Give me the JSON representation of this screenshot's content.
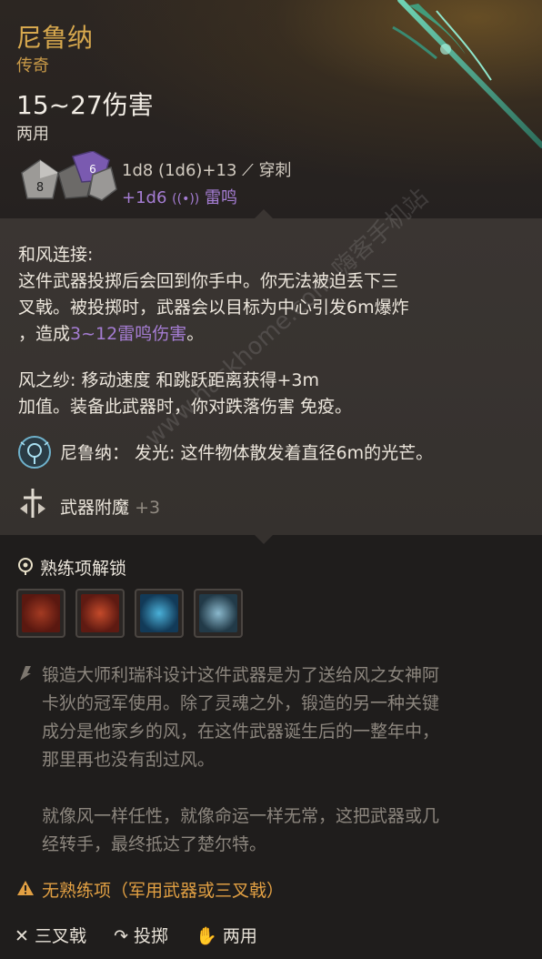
{
  "item": {
    "name": "尼鲁纳",
    "rarity": "传奇",
    "damage": "15~27伤害",
    "handedness": "两用"
  },
  "damage_dice": {
    "formula": "1d8 (1d6)+13",
    "type": "穿刺",
    "extra": "+1d6",
    "extra_type": "雷鸣",
    "dice_faces": [
      "8",
      "6"
    ]
  },
  "abilities": {
    "returning_title": "和风连接:",
    "returning_line1": "这件武器投掷后会回到你手中。你无法被迫丢下三",
    "returning_line2": "叉戟。被投掷时，武器会以目标为中心引发6m爆炸",
    "returning_line3_a": "，造成",
    "returning_line3_b": "3~12雷鸣伤害",
    "returning_line3_c": "。",
    "wind_line1": "风之纱: 移动速度 和跳跃距离获得+3m",
    "wind_line2": "加值。装备此武器时，你对跌落伤害 免疫。",
    "light_text": "尼鲁纳： 发光: 这件物体散发着直径6m的光芒。",
    "enchant_label": "武器附魔",
    "enchant_value": "+3"
  },
  "proficiency": {
    "unlock_title": "熟练项解锁",
    "skills": [
      "skill-1",
      "skill-2",
      "skill-3",
      "skill-4"
    ]
  },
  "lore": {
    "line1": "锻造大师利瑞科设计这件武器是为了送给风之女神阿",
    "line2": "卡狄的冠军使用。除了灵魂之外，锻造的另一种关键",
    "line3": "成分是他家乡的风，在这件武器诞生后的一整年中，",
    "line4": "那里再也没有刮过风。",
    "line5": "就像风一样任性，就像命运一样无常，这把武器或几",
    "line6": "经转手，最终抵达了楚尔特。"
  },
  "warning": {
    "text": "无熟练项（军用武器或三叉戟）"
  },
  "footer": {
    "weapon_type": "三叉戟",
    "throw": "投掷",
    "versatile": "两用"
  },
  "watermark": "www.hackhome.com 嗨客手机站",
  "colors": {
    "title": "#d8a94e",
    "thunder": "#a57dd3",
    "warning": "#e2a043"
  }
}
